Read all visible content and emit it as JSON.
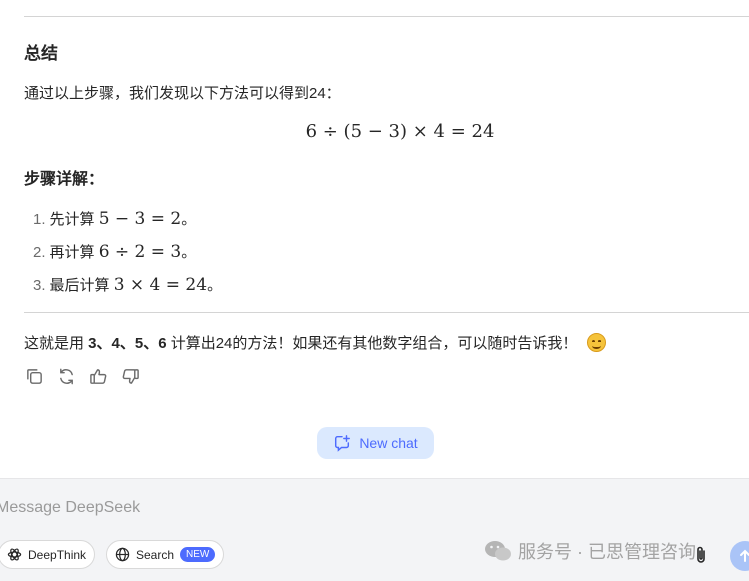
{
  "summary": {
    "heading": "总结",
    "intro": "通过以上步骤，我们发现以下方法可以得到24：",
    "equation": "6 ÷ (5 − 3) × 4 = 24"
  },
  "steps": {
    "heading": "步骤详解：",
    "items": [
      {
        "num": "1.",
        "prefix": "先计算 ",
        "math": "5 − 3 = 2",
        "suffix": "。"
      },
      {
        "num": "2.",
        "prefix": "再计算 ",
        "math": "6 ÷ 2 = 3",
        "suffix": "。"
      },
      {
        "num": "3.",
        "prefix": "最后计算 ",
        "math": "3 × 4 = 24",
        "suffix": "。"
      }
    ]
  },
  "closing": {
    "part1": "这就是用 ",
    "numbers": "3、4、5、6",
    "part2": " 计算出24的方法！如果还有其他数字组合，可以随时告诉我！",
    "emoji": "smiling-face-emoji"
  },
  "actions": {
    "icons": [
      "copy-icon",
      "regenerate-icon",
      "thumbs-up-icon",
      "thumbs-down-icon"
    ]
  },
  "new_chat": {
    "label": "New chat",
    "icon": "new-chat-icon"
  },
  "composer": {
    "placeholder": "Message DeepSeek",
    "deepthink_label": "DeepThink",
    "search_label": "Search",
    "search_badge": "NEW",
    "watermark": "服务号 · 已思管理咨询"
  },
  "colors": {
    "accent": "#4d6bfe",
    "new_chat_bg": "#dbe9fe",
    "send_bg": "#aac4f7",
    "composer_bg": "#f3f4f6"
  }
}
